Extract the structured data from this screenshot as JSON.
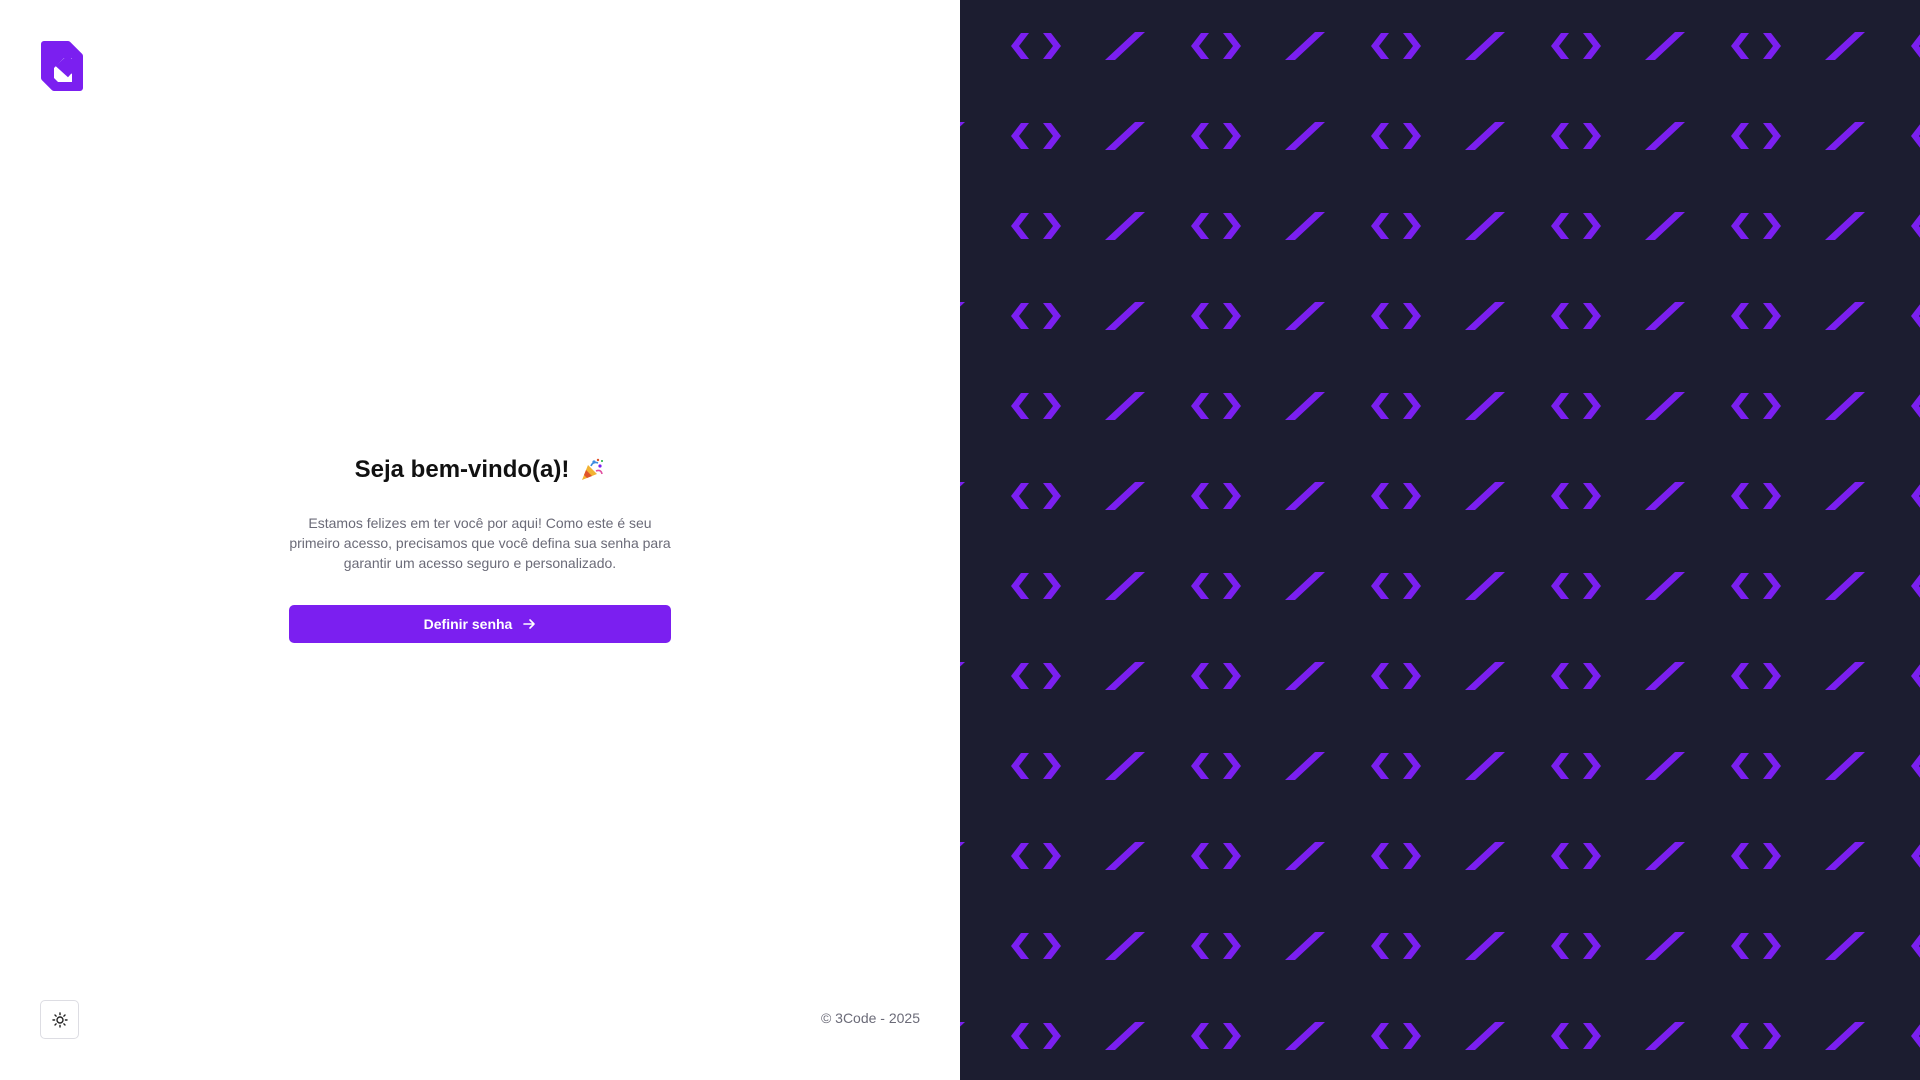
{
  "brand": {
    "logo_icon": "3code-logo-icon",
    "accent_color": "#7b1ff0"
  },
  "welcome": {
    "title": "Seja bem-vindo(a)!",
    "title_emoji_icon": "party-popper-icon",
    "description": "Estamos felizes em ter você por aqui! Como este é seu primeiro acesso, precisamos que você defina sua senha para garantir um acesso seguro e personalizado.",
    "cta_label": "Definir senha",
    "cta_icon": "arrow-right-icon"
  },
  "footer": {
    "theme_toggle_icon": "sun-icon",
    "copyright": "© 3Code - 2025"
  },
  "pattern": {
    "background_color": "#1c1d30",
    "shape_color": "#7b1ff0"
  }
}
